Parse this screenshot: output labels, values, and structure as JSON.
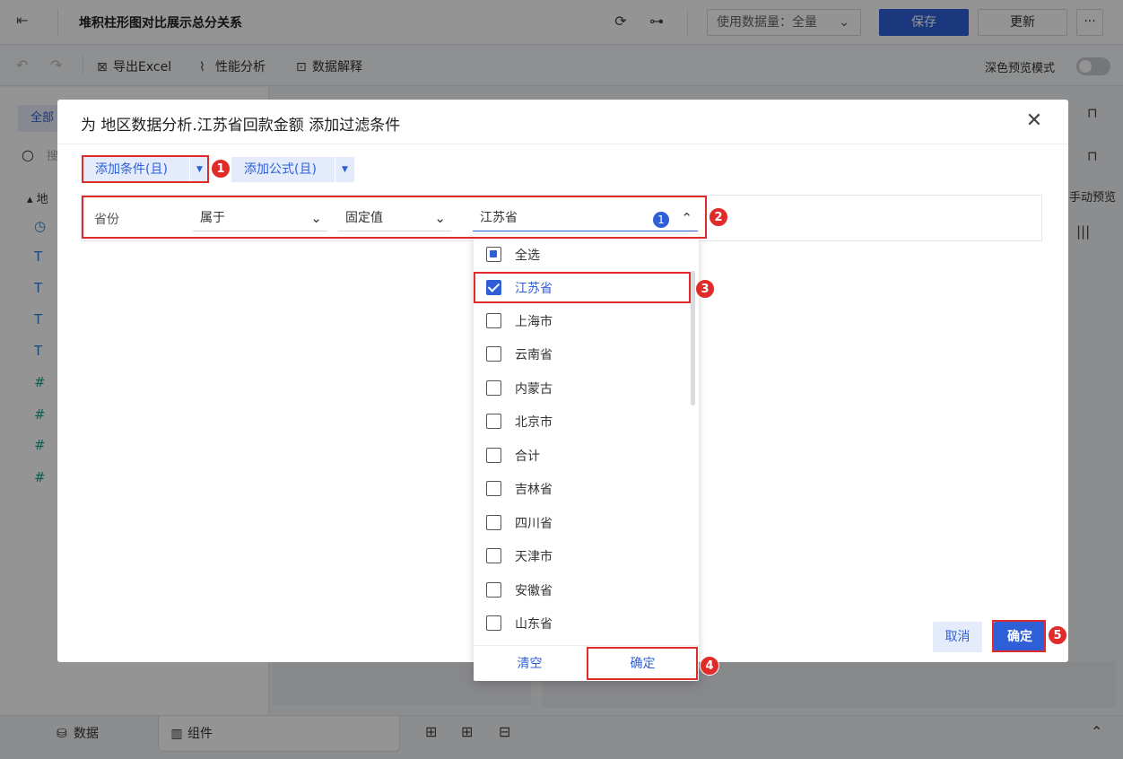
{
  "app": {
    "title": "堆积柱形图对比展示总分关系",
    "data_usage_label": "使用数据量：全量",
    "save_label": "保存",
    "update_label": "更新",
    "more_label": "···"
  },
  "toolbar": {
    "export_excel": "导出Excel",
    "performance": "性能分析",
    "data_explain": "数据解释",
    "dark_preview": "深色预览模式"
  },
  "left": {
    "all_tab": "全部",
    "search_placeholder": "搜",
    "tree_head": "▴ 地"
  },
  "right": {
    "manual_preview": "手动预览"
  },
  "bottom": {
    "data_tab": "数据",
    "component_tab": "组件"
  },
  "modal": {
    "title": "为 地区数据分析.江苏省回款金额 添加过滤条件",
    "add_condition": "添加条件(且)",
    "add_formula": "添加公式(且)",
    "condition": {
      "field": "省份",
      "operator": "属于",
      "value_type": "固定值",
      "value": "江苏省",
      "selected_count": "1"
    },
    "cancel_label": "取消",
    "confirm_label": "确定"
  },
  "dropdown": {
    "options": [
      {
        "label": "全选",
        "state": "indeterminate"
      },
      {
        "label": "江苏省",
        "state": "checked"
      },
      {
        "label": "上海市",
        "state": "unchecked"
      },
      {
        "label": "云南省",
        "state": "unchecked"
      },
      {
        "label": "内蒙古",
        "state": "unchecked"
      },
      {
        "label": "北京市",
        "state": "unchecked"
      },
      {
        "label": "合计",
        "state": "unchecked"
      },
      {
        "label": "吉林省",
        "state": "unchecked"
      },
      {
        "label": "四川省",
        "state": "unchecked"
      },
      {
        "label": "天津市",
        "state": "unchecked"
      },
      {
        "label": "安徽省",
        "state": "unchecked"
      },
      {
        "label": "山东省",
        "state": "unchecked"
      }
    ],
    "clear_label": "清空",
    "confirm_label": "确定"
  },
  "markers": [
    "1",
    "2",
    "3",
    "4",
    "5"
  ],
  "colors": {
    "accent": "#2f5fd7",
    "annotation": "#e02b2b"
  }
}
